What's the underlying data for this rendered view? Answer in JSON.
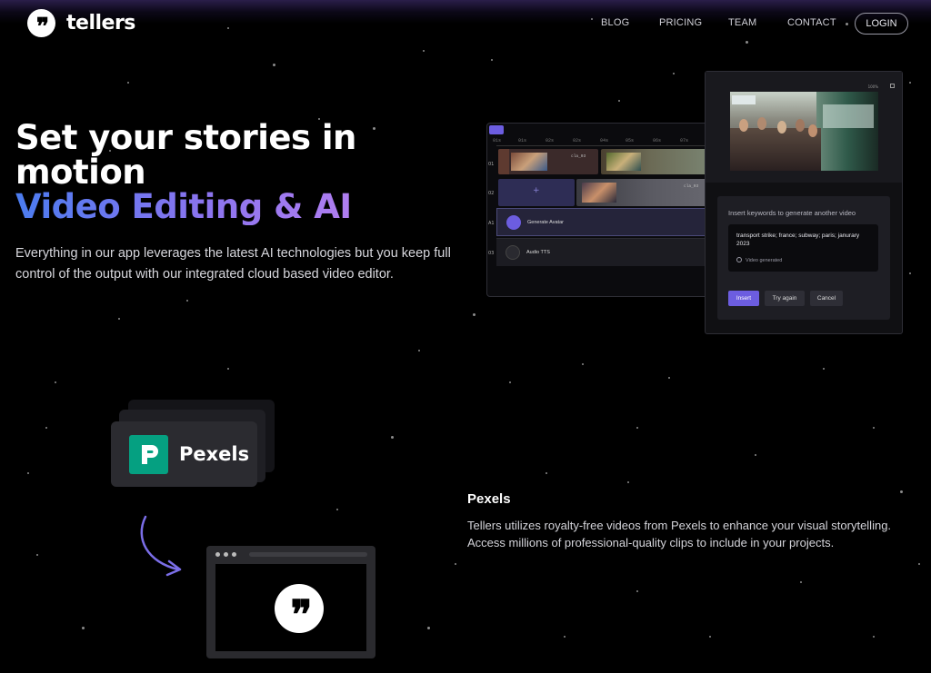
{
  "brand": {
    "name": "tellers",
    "logo_glyph": "❞"
  },
  "nav": {
    "links": [
      "BLOG",
      "PRICING",
      "TEAM",
      "CONTACT"
    ],
    "login_label": "LOGIN"
  },
  "hero": {
    "title_line1": "Set your stories in",
    "title_line2": "motion",
    "subtitle": "Video Editing & AI",
    "description": "Everything in our app leverages the latest AI technologies but you keep full control of the output with our integrated cloud based video editor."
  },
  "editor": {
    "ruler": [
      "01s",
      "01s",
      "02s",
      "02s",
      "04s",
      "05s",
      "06s",
      "07s"
    ],
    "track_labels": [
      "01",
      "02",
      "A1",
      "03"
    ],
    "clips": [
      "cla_03",
      "cla_03"
    ],
    "rows": [
      "Generate Avatar",
      "Audio TTS"
    ]
  },
  "ai_panel": {
    "zoom": "100%",
    "prompt_label": "Insert keywords to generate another video",
    "keywords": "transport strike; france; subway; paris; janurary 2023",
    "status": "Video generated",
    "buttons": {
      "insert": "Insert",
      "try_again": "Try again",
      "cancel": "Cancel"
    },
    "accent": "#6c5de0"
  },
  "pexels_section": {
    "card_label": "Pexels",
    "title": "Pexels",
    "description": "Tellers utilizes royalty-free videos from Pexels to enhance your visual storytelling. Access millions of professional-quality clips to include in your projects.",
    "brand_color": "#05a081"
  },
  "colors": {
    "background": "#000000",
    "gradient_start": "#4b7cf0",
    "gradient_end": "#b07ef0"
  }
}
